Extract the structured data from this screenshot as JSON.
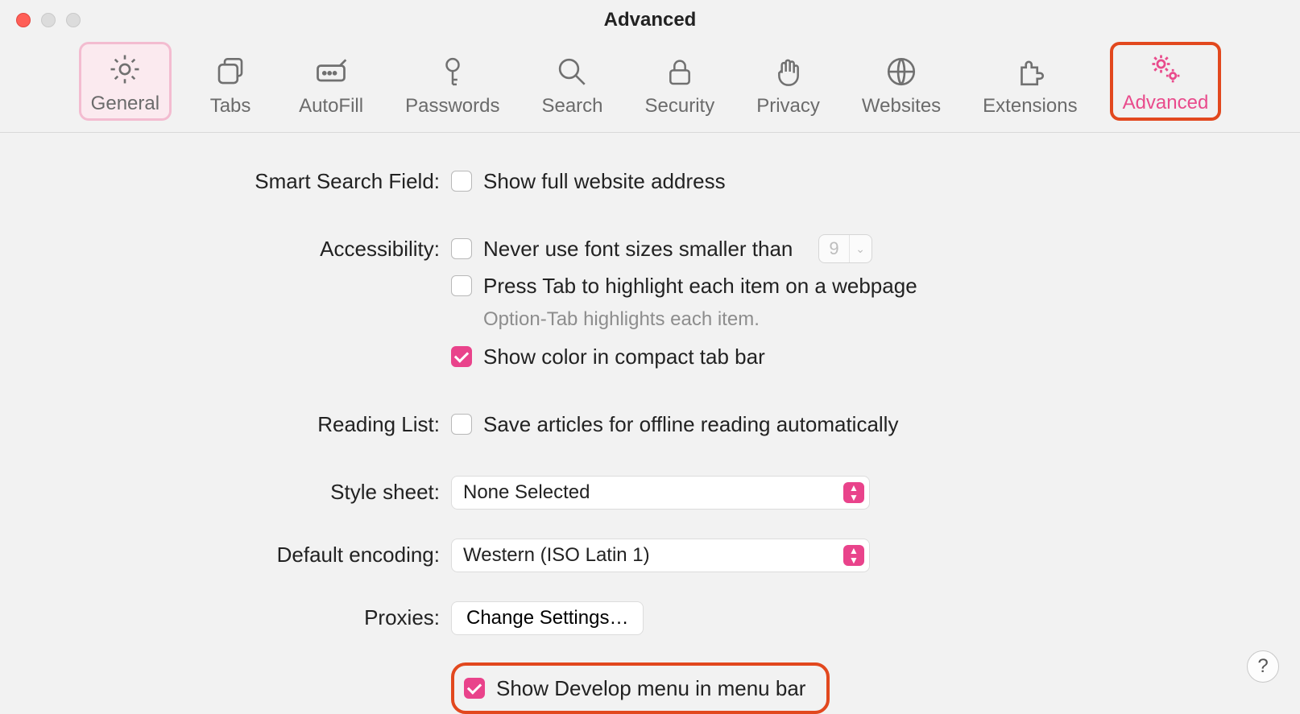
{
  "window": {
    "title": "Advanced"
  },
  "toolbar": {
    "items": [
      {
        "label": "General"
      },
      {
        "label": "Tabs"
      },
      {
        "label": "AutoFill"
      },
      {
        "label": "Passwords"
      },
      {
        "label": "Search"
      },
      {
        "label": "Security"
      },
      {
        "label": "Privacy"
      },
      {
        "label": "Websites"
      },
      {
        "label": "Extensions"
      },
      {
        "label": "Advanced"
      }
    ]
  },
  "sections": {
    "smart_search": {
      "label": "Smart Search Field:",
      "show_full_address": "Show full website address"
    },
    "accessibility": {
      "label": "Accessibility:",
      "never_smaller": "Never use font sizes smaller than",
      "font_size": "9",
      "press_tab": "Press Tab to highlight each item on a webpage",
      "hint": "Option-Tab highlights each item.",
      "show_color": "Show color in compact tab bar"
    },
    "reading_list": {
      "label": "Reading List:",
      "save_offline": "Save articles for offline reading automatically"
    },
    "style_sheet": {
      "label": "Style sheet:",
      "value": "None Selected"
    },
    "default_encoding": {
      "label": "Default encoding:",
      "value": "Western (ISO Latin 1)"
    },
    "proxies": {
      "label": "Proxies:",
      "button": "Change Settings…"
    },
    "develop": {
      "label": "Show Develop menu in menu bar"
    }
  },
  "help": "?"
}
